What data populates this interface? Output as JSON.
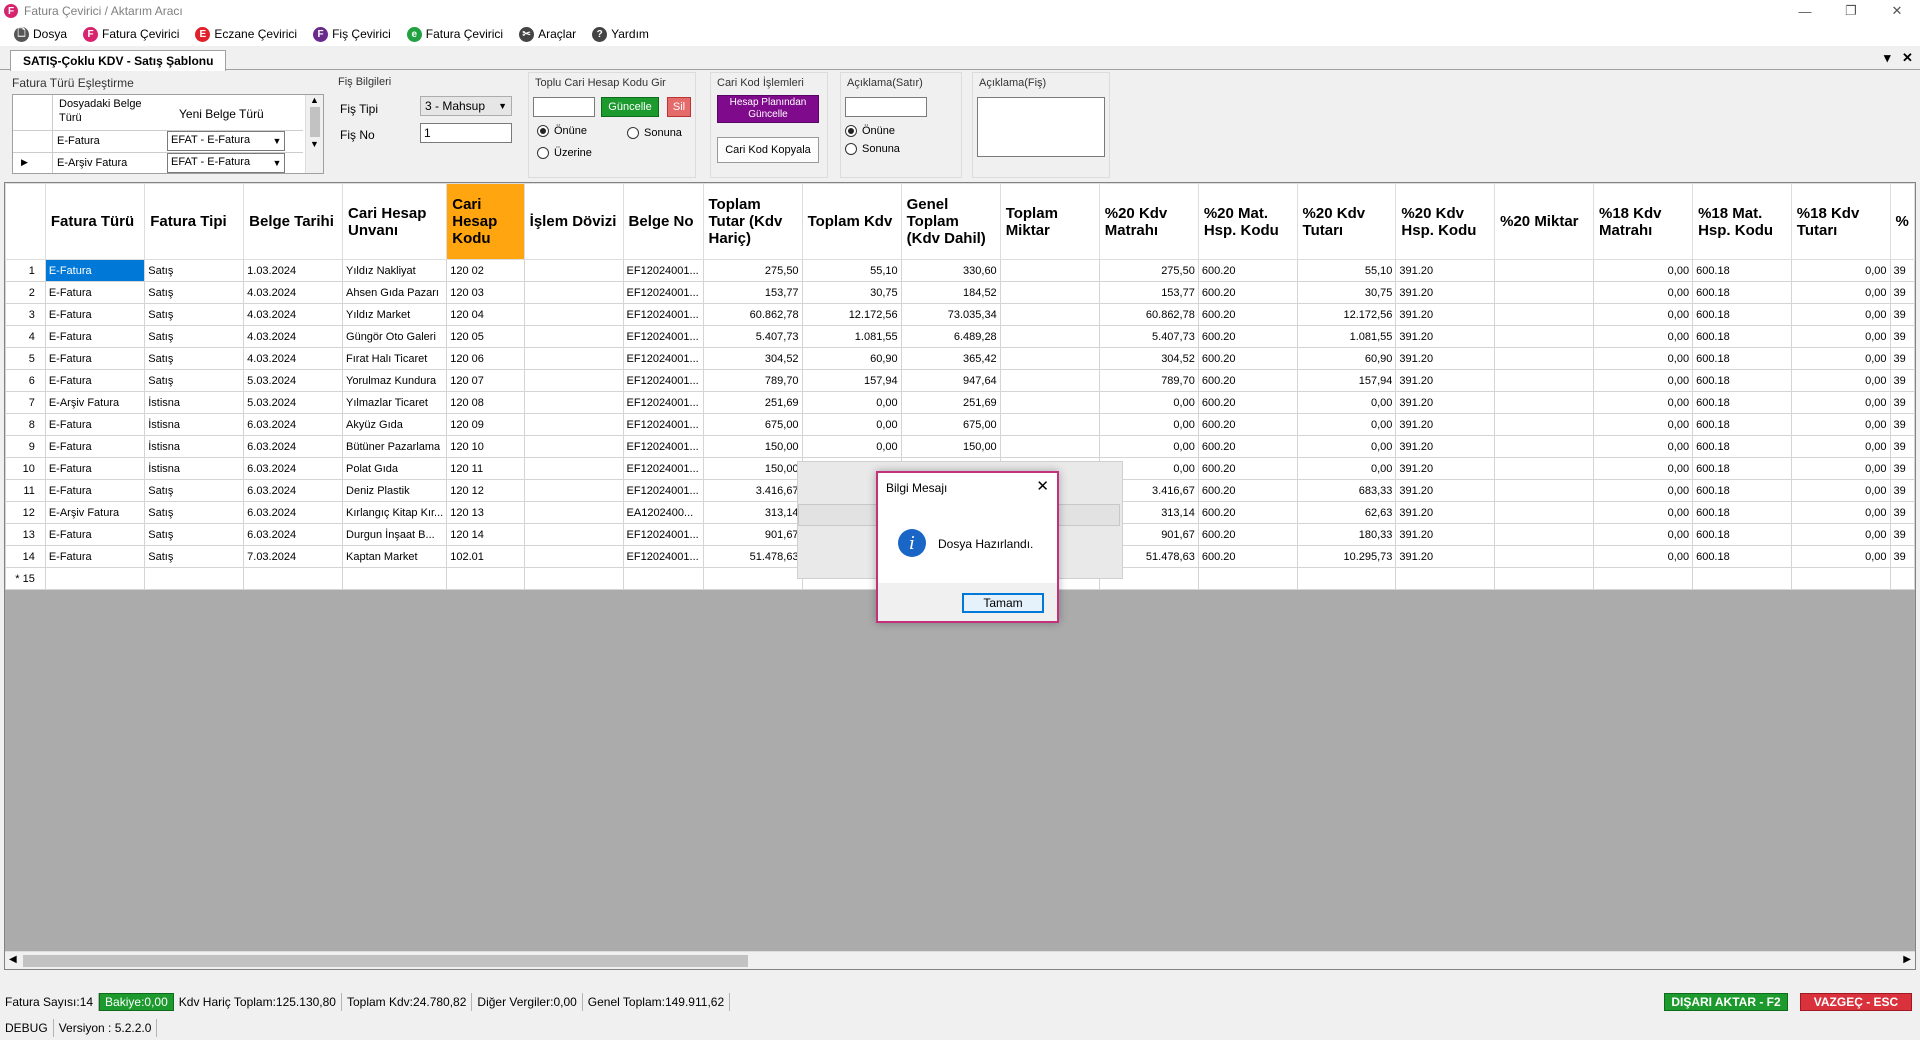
{
  "window": {
    "title": "Fatura Çevirici / Aktarım Aracı",
    "icon_letter": "F",
    "controls": [
      "—",
      "❐",
      "✕"
    ]
  },
  "menu": [
    {
      "label": "Dosya",
      "icon": "file-icon",
      "color": "#555555",
      "glyph": "🗋"
    },
    {
      "label": "Fatura Çevirici",
      "icon": "fatura-icon",
      "color": "#d6246e",
      "glyph": "F"
    },
    {
      "label": "Eczane Çevirici",
      "icon": "eczane-icon",
      "color": "#e0202a",
      "glyph": "E"
    },
    {
      "label": "Fiş Çevirici",
      "icon": "fis-icon",
      "color": "#6a2a8a",
      "glyph": "F"
    },
    {
      "label": "Fatura Çevirici",
      "icon": "efatura-icon",
      "color": "#22a142",
      "glyph": "e"
    },
    {
      "label": "Araçlar",
      "icon": "tools-icon",
      "color": "#444444",
      "glyph": "✂"
    },
    {
      "label": "Yardım",
      "icon": "help-icon",
      "color": "#444444",
      "glyph": "?"
    }
  ],
  "tab": {
    "label": "SATIŞ-Çoklu KDV - Satış Şablonu",
    "dropdown_glyph": "▾",
    "close_glyph": "✕"
  },
  "mapping": {
    "title": "Fatura Türü Eşleştirme",
    "col1": "Dosyadaki Belge Türü",
    "col2": "Yeni Belge Türü",
    "rows": [
      {
        "source": "E-Fatura",
        "target": "EFAT - E-Fatura"
      },
      {
        "source": "E-Arşiv Fatura",
        "target": "EFAT - E-Fatura"
      }
    ]
  },
  "fis": {
    "title": "Fiş Bilgileri",
    "tip_label": "Fiş Tipi",
    "tip_value": "3 - Mahsup",
    "no_label": "Fiş No",
    "no_value": "1"
  },
  "toplu": {
    "title": "Toplu Cari Hesap Kodu Gir",
    "update": "Güncelle",
    "delete": "Sil",
    "opt1": "Önüne",
    "opt2": "Sonuna",
    "opt3": "Üzerine"
  },
  "cari": {
    "title": "Cari Kod İşlemleri",
    "update_plan": "Hesap Planından Güncelle",
    "copy": "Cari Kod Kopyala"
  },
  "aciklama_satir": {
    "title": "Açıklama(Satır)",
    "opt1": "Önüne",
    "opt2": "Sonuna"
  },
  "aciklama_fis": {
    "title": "Açıklama(Fiş)"
  },
  "grid": {
    "columns": [
      "Fatura Türü",
      "Fatura Tipi",
      "Belge Tarihi",
      "Cari Hesap Unvanı",
      "Cari Hesap Kodu",
      "İşlem Dövizi",
      "Belge No",
      "Toplam Tutar (Kdv Hariç)",
      "Toplam Kdv",
      "Genel Toplam (Kdv Dahil)",
      "Toplam Miktar",
      "%20 Kdv Matrahı",
      "%20 Mat. Hsp. Kodu",
      "%20 Kdv Tutarı",
      "%20 Kdv Hsp. Kodu",
      "%20 Miktar",
      "%18 Kdv Matrahı",
      "%18 Mat. Hsp. Kodu",
      "%18 Kdv Tutarı",
      "%"
    ],
    "rows": [
      [
        "1",
        "E-Fatura",
        "Satış",
        "1.03.2024",
        "Yıldız Nakliyat",
        "120 02",
        "",
        "EF12024001...",
        "275,50",
        "55,10",
        "330,60",
        "",
        "275,50",
        "600.20",
        "55,10",
        "391.20",
        "",
        "0,00",
        "600.18",
        "0,00",
        "39"
      ],
      [
        "2",
        "E-Fatura",
        "Satış",
        "4.03.2024",
        "Ahsen Gıda Pazarı",
        "120 03",
        "",
        "EF12024001...",
        "153,77",
        "30,75",
        "184,52",
        "",
        "153,77",
        "600.20",
        "30,75",
        "391.20",
        "",
        "0,00",
        "600.18",
        "0,00",
        "39"
      ],
      [
        "3",
        "E-Fatura",
        "Satış",
        "4.03.2024",
        "Yıldız Market",
        "120 04",
        "",
        "EF12024001...",
        "60.862,78",
        "12.172,56",
        "73.035,34",
        "",
        "60.862,78",
        "600.20",
        "12.172,56",
        "391.20",
        "",
        "0,00",
        "600.18",
        "0,00",
        "39"
      ],
      [
        "4",
        "E-Fatura",
        "Satış",
        "4.03.2024",
        "Güngör Oto Galeri",
        "120 05",
        "",
        "EF12024001...",
        "5.407,73",
        "1.081,55",
        "6.489,28",
        "",
        "5.407,73",
        "600.20",
        "1.081,55",
        "391.20",
        "",
        "0,00",
        "600.18",
        "0,00",
        "39"
      ],
      [
        "5",
        "E-Fatura",
        "Satış",
        "4.03.2024",
        "Fırat Halı Ticaret",
        "120 06",
        "",
        "EF12024001...",
        "304,52",
        "60,90",
        "365,42",
        "",
        "304,52",
        "600.20",
        "60,90",
        "391.20",
        "",
        "0,00",
        "600.18",
        "0,00",
        "39"
      ],
      [
        "6",
        "E-Fatura",
        "Satış",
        "5.03.2024",
        "Yorulmaz Kundura",
        "120 07",
        "",
        "EF12024001...",
        "789,70",
        "157,94",
        "947,64",
        "",
        "789,70",
        "600.20",
        "157,94",
        "391.20",
        "",
        "0,00",
        "600.18",
        "0,00",
        "39"
      ],
      [
        "7",
        "E-Arşiv Fatura",
        "İstisna",
        "5.03.2024",
        "Yılmazlar Ticaret",
        "120 08",
        "",
        "EF12024001...",
        "251,69",
        "0,00",
        "251,69",
        "",
        "0,00",
        "600.20",
        "0,00",
        "391.20",
        "",
        "0,00",
        "600.18",
        "0,00",
        "39"
      ],
      [
        "8",
        "E-Fatura",
        "İstisna",
        "6.03.2024",
        "Akyüz Gıda",
        "120 09",
        "",
        "EF12024001...",
        "675,00",
        "0,00",
        "675,00",
        "",
        "0,00",
        "600.20",
        "0,00",
        "391.20",
        "",
        "0,00",
        "600.18",
        "0,00",
        "39"
      ],
      [
        "9",
        "E-Fatura",
        "İstisna",
        "6.03.2024",
        "Bütüner Pazarlama",
        "120 10",
        "",
        "EF12024001...",
        "150,00",
        "0,00",
        "150,00",
        "",
        "0,00",
        "600.20",
        "0,00",
        "391.20",
        "",
        "0,00",
        "600.18",
        "0,00",
        "39"
      ],
      [
        "10",
        "E-Fatura",
        "İstisna",
        "6.03.2024",
        "Polat Gıda",
        "120 11",
        "",
        "EF12024001...",
        "150,00",
        "",
        "",
        "",
        "0,00",
        "600.20",
        "0,00",
        "391.20",
        "",
        "0,00",
        "600.18",
        "0,00",
        "39"
      ],
      [
        "11",
        "E-Fatura",
        "Satış",
        "6.03.2024",
        "Deniz Plastik",
        "120 12",
        "",
        "EF12024001...",
        "3.416,67",
        "",
        "",
        "",
        "3.416,67",
        "600.20",
        "683,33",
        "391.20",
        "",
        "0,00",
        "600.18",
        "0,00",
        "39"
      ],
      [
        "12",
        "E-Arşiv Fatura",
        "Satış",
        "6.03.2024",
        "Kırlangıç Kitap Kır...",
        "120 13",
        "",
        "EA1202400...",
        "313,14",
        "",
        "",
        "",
        "313,14",
        "600.20",
        "62,63",
        "391.20",
        "",
        "0,00",
        "600.18",
        "0,00",
        "39"
      ],
      [
        "13",
        "E-Fatura",
        "Satış",
        "6.03.2024",
        "Durgun İnşaat B...",
        "120 14",
        "",
        "EF12024001...",
        "901,67",
        "",
        "",
        "",
        "901,67",
        "600.20",
        "180,33",
        "391.20",
        "",
        "0,00",
        "600.18",
        "0,00",
        "39"
      ],
      [
        "14",
        "E-Fatura",
        "Satış",
        "7.03.2024",
        "Kaptan Market",
        "102.01",
        "",
        "EF12024001...",
        "51.478,63",
        "",
        "",
        "",
        "51.478,63",
        "600.20",
        "10.295,73",
        "391.20",
        "",
        "0,00",
        "600.18",
        "0,00",
        "39"
      ]
    ],
    "new_row_marker": "* 15"
  },
  "dialog": {
    "title": "Bilgi Mesajı",
    "message": "Dosya Hazırlandı.",
    "ok": "Tamam",
    "info_glyph": "i",
    "close_glyph": "✕"
  },
  "status": {
    "fatura_sayisi": "Fatura Sayısı:14",
    "bakiye": "Bakiye:0,00",
    "kdv_haric": "Kdv Hariç Toplam:125.130,80",
    "toplam_kdv": "Toplam Kdv:24.780,82",
    "diger": "Diğer Vergiler:0,00",
    "genel": "Genel Toplam:149.911,62",
    "export": "DIŞARI AKTAR - F2",
    "cancel": "VAZGEÇ - ESC",
    "debug": "DEBUG",
    "version": "Versiyon : 5.2.2.0"
  },
  "colors": {
    "accent_orange": "#ffa510",
    "selection": "#0078d7",
    "export_green": "#1c9a2e",
    "cancel_red": "#d9323c",
    "purple": "#800a8c",
    "dialog_border": "#c2317a"
  }
}
